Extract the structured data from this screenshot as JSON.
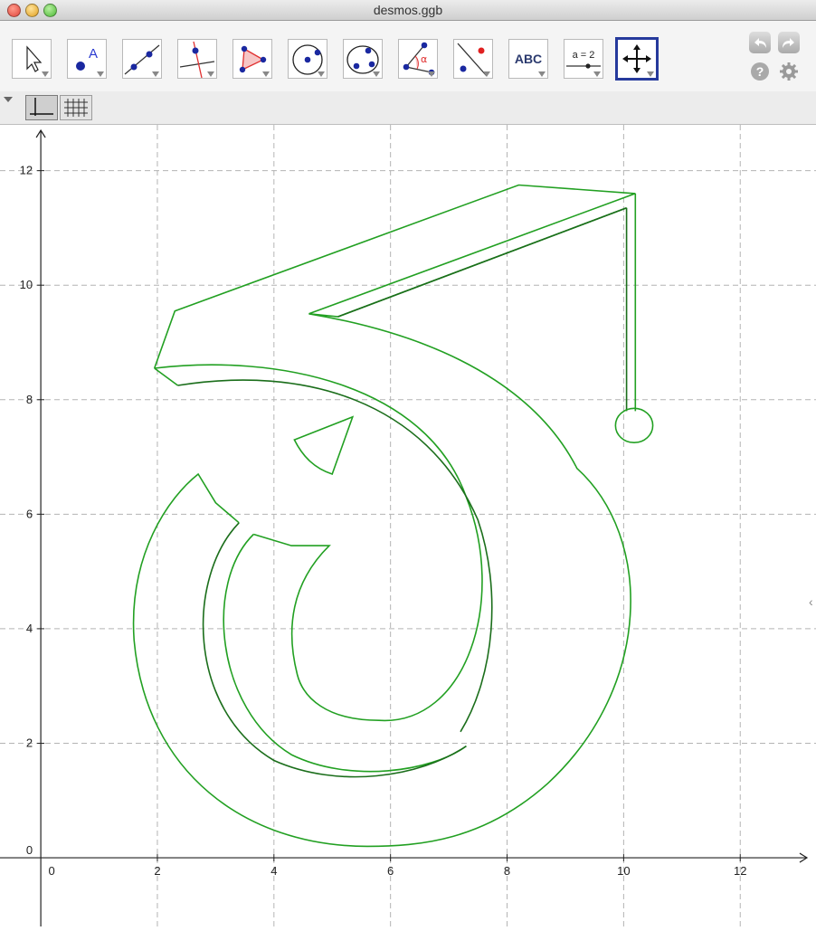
{
  "window": {
    "title": "desmos.ggb"
  },
  "toolbar": {
    "tools": [
      {
        "name": "move-tool",
        "icon": "arrow-pointer-icon"
      },
      {
        "name": "point-tool",
        "icon": "point-A-icon",
        "label": "A"
      },
      {
        "name": "line-tool",
        "icon": "line-through-two-points-icon"
      },
      {
        "name": "perpendicular-line-tool",
        "icon": "perpendicular-line-icon"
      },
      {
        "name": "polygon-tool",
        "icon": "polygon-icon"
      },
      {
        "name": "circle-tool",
        "icon": "circle-center-point-icon"
      },
      {
        "name": "conic-tool",
        "icon": "circle-through-points-icon"
      },
      {
        "name": "angle-tool",
        "icon": "angle-icon",
        "label": "α"
      },
      {
        "name": "reflect-tool",
        "icon": "reflect-about-line-icon"
      },
      {
        "name": "text-tool",
        "icon": "text-icon",
        "label": "ABC"
      },
      {
        "name": "slider-tool",
        "icon": "slider-icon",
        "label": "a = 2"
      },
      {
        "name": "move-graphics-view-tool",
        "icon": "move-graphics-view-icon"
      }
    ],
    "active_tool": "move-graphics-view-tool",
    "help_label": "?",
    "undo_icon": "undo-icon",
    "redo_icon": "redo-icon",
    "settings_icon": "gear-icon"
  },
  "stylebar": {
    "buttons": [
      "show-axes-button",
      "show-grid-button"
    ]
  },
  "graph": {
    "x_ticks": [
      "0",
      "2",
      "4",
      "6",
      "8",
      "10",
      "12"
    ],
    "y_ticks": [
      "0",
      "2",
      "4",
      "6",
      "8",
      "10",
      "12"
    ],
    "x_range": [
      -0.7,
      13.3
    ],
    "y_range": [
      -1.2,
      12.8
    ],
    "grid": true,
    "stroke_color": "#22a022",
    "stroke_dark": "#1b6e1b",
    "grid_color": "#b4b4b4"
  }
}
